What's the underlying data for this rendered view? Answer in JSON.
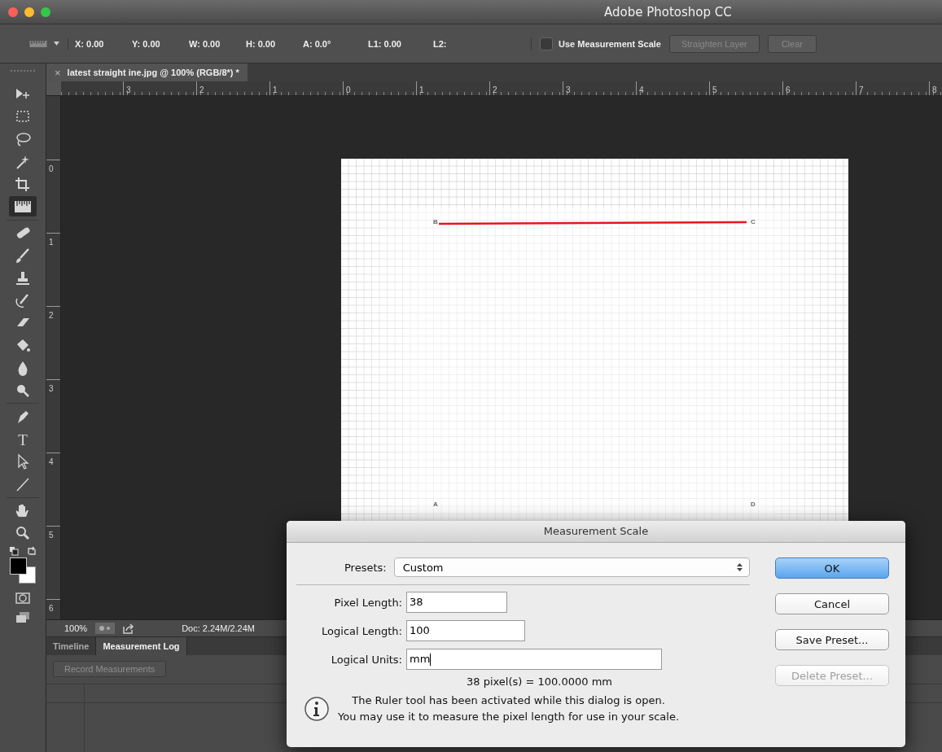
{
  "window": {
    "title": "Adobe Photoshop CC"
  },
  "options_bar": {
    "readings": [
      "X: 0.00",
      "Y: 0.00",
      "W: 0.00",
      "H: 0.00",
      "A: 0.0°",
      "L1: 0.00",
      "L2:"
    ],
    "use_measurement_scale": {
      "label": "Use Measurement Scale",
      "checked": false
    },
    "buttons": [
      {
        "label": "Straighten Layer",
        "disabled": true
      },
      {
        "label": "Clear",
        "disabled": true
      }
    ]
  },
  "document_tab": {
    "title": "latest straight ine.jpg @ 100% (RGB/8*) *",
    "close": "×"
  },
  "horizontal_ruler": [
    "3",
    "2",
    "1",
    "0",
    "1",
    "2",
    "3",
    "4",
    "5",
    "6",
    "7",
    "8"
  ],
  "vertical_ruler": [
    "0",
    "1",
    "2",
    "3",
    "4",
    "5",
    "6"
  ],
  "tools": [
    {
      "kind": "move",
      "selected": false
    },
    {
      "kind": "marquee",
      "selected": false
    },
    {
      "kind": "lasso",
      "selected": false
    },
    {
      "kind": "wand",
      "selected": false
    },
    {
      "kind": "crop",
      "selected": false
    },
    {
      "kind": "ruler",
      "selected": true
    },
    {
      "kind": "bandage",
      "selected": false
    },
    {
      "kind": "brush",
      "selected": false
    },
    {
      "kind": "stamp",
      "selected": false
    },
    {
      "kind": "history",
      "selected": false
    },
    {
      "kind": "eraser",
      "selected": false
    },
    {
      "kind": "bucket",
      "selected": false
    },
    {
      "kind": "drop",
      "selected": false
    },
    {
      "kind": "dodge",
      "selected": false
    },
    {
      "kind": "pen",
      "selected": false
    },
    {
      "kind": "type",
      "label": "T",
      "selected": false
    },
    {
      "kind": "pointer",
      "selected": false
    },
    {
      "kind": "line",
      "selected": false
    },
    {
      "kind": "hand",
      "selected": false
    },
    {
      "kind": "zoom",
      "selected": false
    }
  ],
  "document": {
    "points": [
      {
        "label": "B",
        "kind": "corner"
      },
      {
        "label": "C",
        "kind": "corner"
      },
      {
        "label": "A",
        "kind": "corner"
      },
      {
        "label": "D",
        "kind": "corner"
      }
    ]
  },
  "status_bar": {
    "zoom": "100%",
    "doc": "Doc: 2.24M/2.24M"
  },
  "panel": {
    "tabs": [
      {
        "label": "Timeline",
        "selected": false
      },
      {
        "label": "Measurement Log",
        "selected": true
      }
    ],
    "record_button": {
      "label": "Record Measurements",
      "disabled": true
    }
  },
  "dialog": {
    "title": "Measurement Scale",
    "presets": {
      "label": "Presets:",
      "value": "Custom"
    },
    "fields": [
      {
        "label": "Pixel Length:",
        "value": "38",
        "focused": false
      },
      {
        "label": "Logical Length:",
        "value": "100",
        "focused": false
      },
      {
        "label": "Logical Units:",
        "value": "mm",
        "focused": true
      }
    ],
    "result": "38 pixel(s) = 100.0000 mm",
    "message": [
      "The Ruler tool has been activated while this dialog is open.",
      "You may use it to measure the pixel length for use in your scale."
    ],
    "buttons": [
      {
        "label": "OK",
        "default": true,
        "disabled": false
      },
      {
        "label": "Cancel",
        "default": false,
        "disabled": false
      },
      {
        "label": "Save Preset...",
        "default": false,
        "disabled": false
      },
      {
        "label": "Delete Preset...",
        "default": false,
        "disabled": true
      }
    ]
  }
}
